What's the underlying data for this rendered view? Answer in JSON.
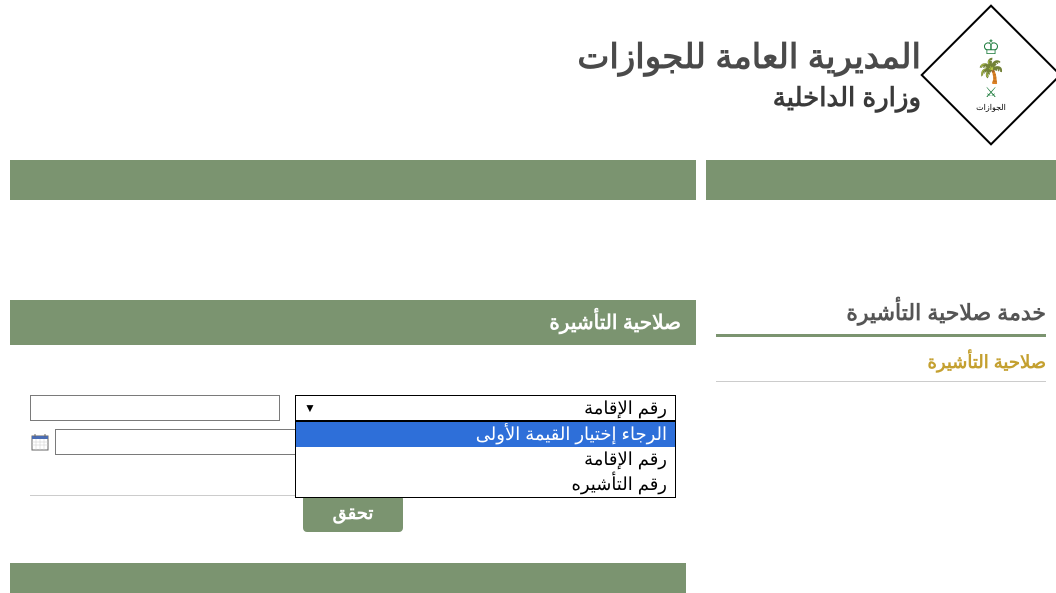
{
  "header": {
    "title": "المديرية العامة للجوازات",
    "subtitle": "وزارة الداخلية",
    "logo_label": "الجوازات"
  },
  "sidebar": {
    "service_title": "خدمة صلاحية التأشيرة",
    "link": "صلاحية التأشيرة"
  },
  "form": {
    "header": "صلاحية التأشيرة",
    "select_value": "رقم الإقامة",
    "dropdown_options": {
      "opt0": "الرجاء إختيار القيمة الأولى",
      "opt1": "رقم الإقامة",
      "opt2": "رقم التأشيره"
    },
    "submit_label": "تحقق"
  }
}
